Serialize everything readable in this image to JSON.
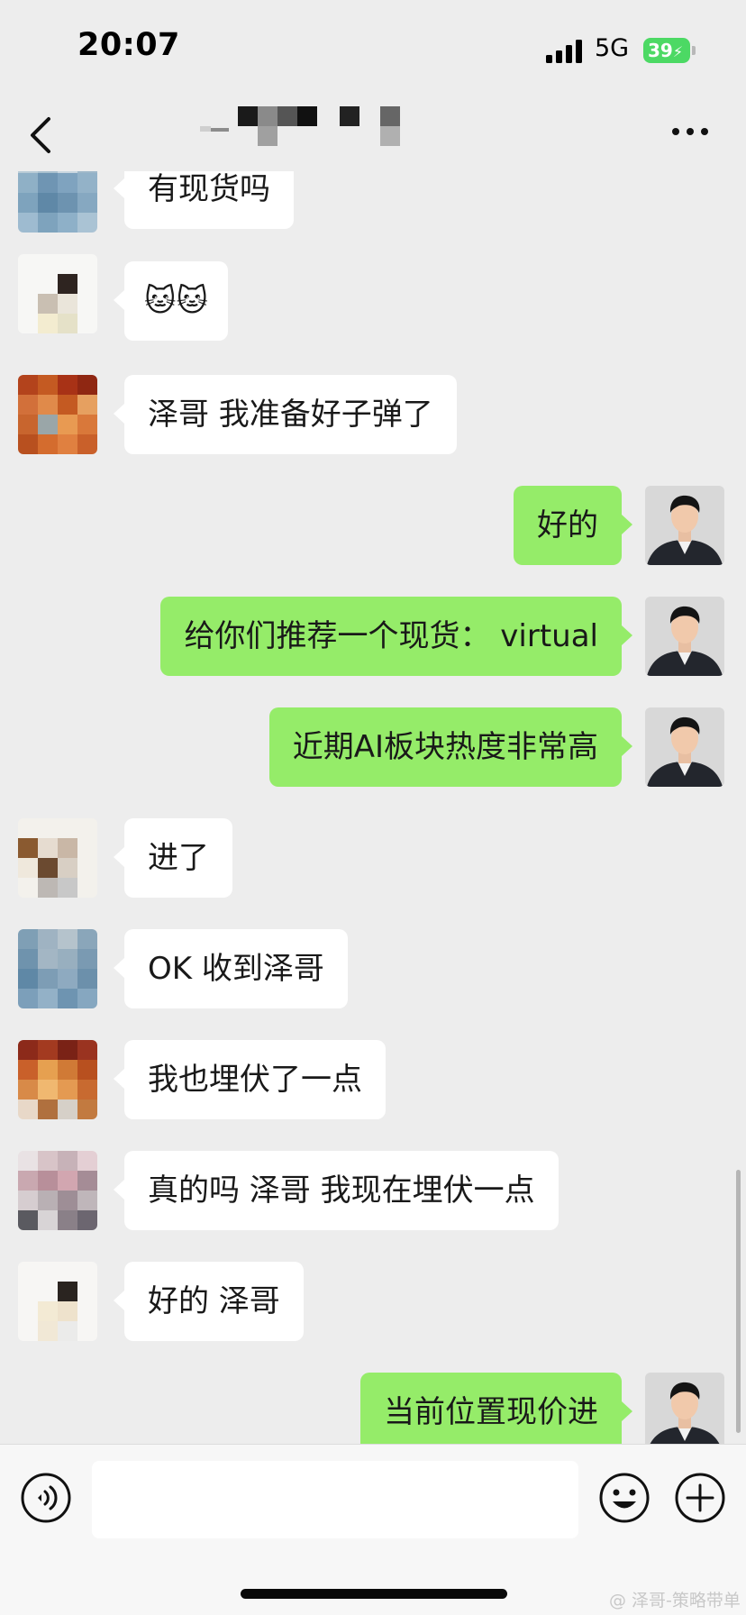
{
  "status_bar": {
    "time": "20:07",
    "network": "5G",
    "battery": "39",
    "battery_color": "#4cd964"
  },
  "header": {
    "back_icon": "chevron-left-icon",
    "more_icon": "more-dots-icon"
  },
  "colors": {
    "incoming_bubble": "#ffffff",
    "outgoing_bubble": "#95ec69",
    "background": "#ededed"
  },
  "messages": [
    {
      "side": "in",
      "text": "有现货吗"
    },
    {
      "side": "in",
      "text": "🐱🐱"
    },
    {
      "side": "in",
      "text": "泽哥 我准备好子弹了"
    },
    {
      "side": "out",
      "text": "好的"
    },
    {
      "side": "out",
      "text": "给你们推荐一个现货： virtual"
    },
    {
      "side": "out",
      "text": "近期AI板块热度非常高"
    },
    {
      "side": "in",
      "text": "进了"
    },
    {
      "side": "in",
      "text": "OK 收到泽哥"
    },
    {
      "side": "in",
      "text": "我也埋伏了一点"
    },
    {
      "side": "in",
      "text": "真的吗 泽哥 我现在埋伏一点"
    },
    {
      "side": "in",
      "text": " 好的 泽哥"
    },
    {
      "side": "out",
      "text": "当前位置现价进"
    }
  ],
  "input_bar": {
    "voice_icon": "voice-icon",
    "emoji_icon": "emoji-icon",
    "plus_icon": "plus-circle-icon",
    "placeholder": ""
  },
  "watermark": "@ 泽哥-策略带单"
}
